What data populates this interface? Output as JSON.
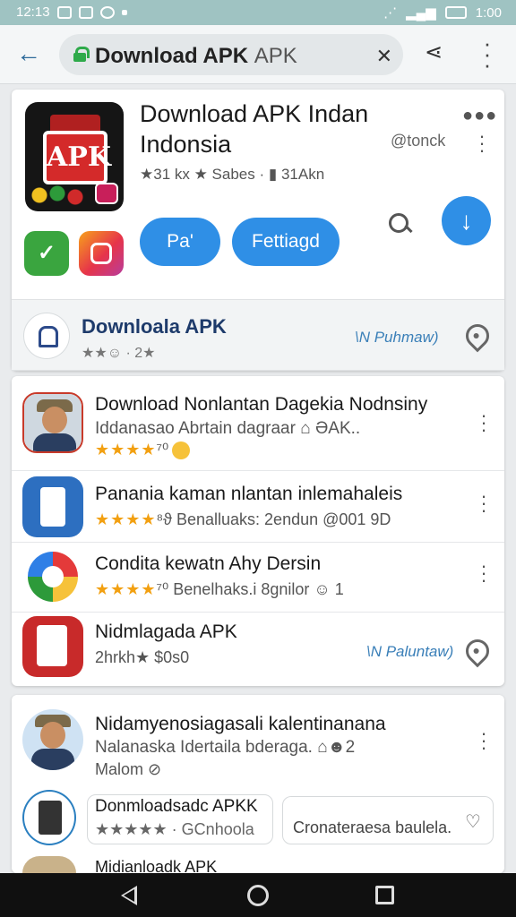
{
  "status_bar": {
    "time": "12:13",
    "battery_time": "1:00"
  },
  "appbar": {
    "url_bold": "Download APK",
    "url_dim": "APK"
  },
  "app": {
    "title": "Download APK Indan Indonsia",
    "developer": "@tonck",
    "meta": "★31 kx ★ Sabes · ▮ 31Akn",
    "button_primary": "Pa'",
    "button_secondary": "Fettiagd",
    "icon_text": "APK"
  },
  "section": {
    "title": "Downloala APK",
    "sub": "★★☺ · 2★",
    "link": "\\N Puhmaw)"
  },
  "items": [
    {
      "title": "Download Nonlantan Dagekia Nodnsiny",
      "sub": "Iddanasao Abrtain dagraar ⌂ ƏAK..",
      "meta_stars": "★★★★",
      "meta_text": "⁷⁰"
    },
    {
      "title": "Panania kaman nlantan inlemahaleis",
      "sub": "",
      "meta_stars": "★★★★",
      "meta_text": "⁸ϑ Benalluaks: 2endun @001 9D"
    },
    {
      "title": "Condita kewatn Ahy Dersin",
      "sub": "",
      "meta_stars": "★★★★",
      "meta_text": "⁷⁰ Benelhaks.i 8gnilor ☺ 1"
    },
    {
      "title": "Nidmlagada APK",
      "sub": "",
      "meta_stars": "",
      "meta_text": "2hrkh★ $0s0",
      "link": "\\N Paluntaw)"
    }
  ],
  "lower": {
    "item1_title": "Nidamyenosiagasali kalentinanana",
    "item1_sub": "Nalanaska Idertaila bderaga. ⌂☻2",
    "item1_meta": "Malom ⊘",
    "item2_title": "Donmloadsadc APKK",
    "item2_meta": "★★★★★ · GCnhoola",
    "chip_text": "Cronateraesa baulela.",
    "item3_title": "Midianloadk APK"
  }
}
